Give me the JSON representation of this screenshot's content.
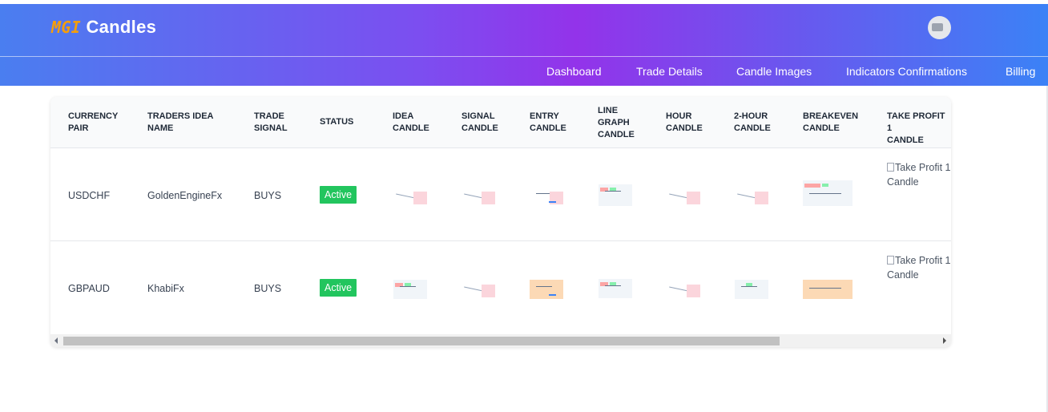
{
  "brand": {
    "prefix": "MGI",
    "name": "Candles"
  },
  "colors": {
    "accent_orange": "#f59e0b",
    "status_active": "#22c55e",
    "gradient_mid": "#9333ea"
  },
  "nav": {
    "items": [
      {
        "label": "Dashboard"
      },
      {
        "label": "Trade Details"
      },
      {
        "label": "Candle Images"
      },
      {
        "label": "Indicators Confirmations"
      },
      {
        "label": "Billing"
      }
    ]
  },
  "table": {
    "headers": [
      "CURRENCY\nPAIR",
      "TRADERS IDEA\nNAME",
      "TRADE\nSIGNAL",
      "STATUS",
      "IDEA\nCANDLE",
      "SIGNAL\nCANDLE",
      "ENTRY\nCANDLE",
      "LINE\nGRAPH\nCANDLE",
      "HOUR\nCANDLE",
      "2-HOUR\nCANDLE",
      "BREAKEVEN\nCANDLE",
      "TAKE PROFIT 1\nCANDLE"
    ],
    "rows": [
      {
        "pair": "USDCHF",
        "trader": "GoldenEngineFx",
        "signal": "BUYS",
        "status": "Active",
        "broken_image_alt": "Take Profit 1 Candle"
      },
      {
        "pair": "GBPAUD",
        "trader": "KhabiFx",
        "signal": "BUYS",
        "status": "Active",
        "broken_image_alt": "Take Profit 1 Candle"
      }
    ]
  }
}
